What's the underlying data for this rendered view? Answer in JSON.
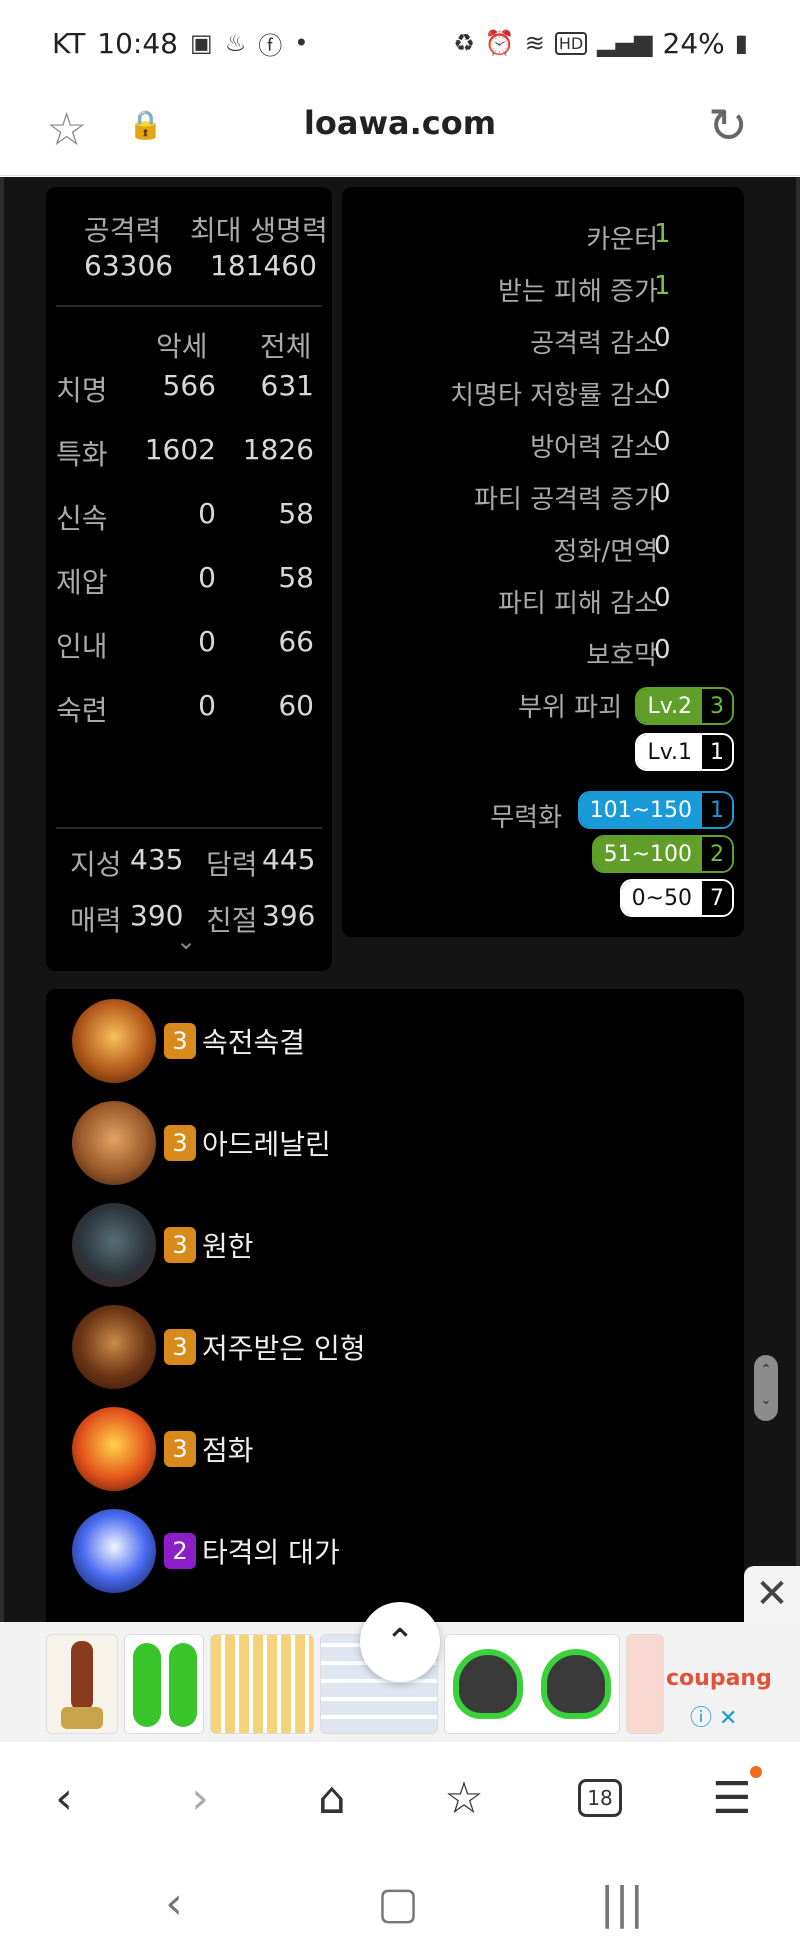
{
  "status": {
    "carrier": "KT",
    "time": "10:48",
    "battery": "24%",
    "icons_left": [
      "image-icon",
      "notification-icon",
      "facebook-icon",
      "dot-icon"
    ],
    "icons_right": [
      "recycle-icon",
      "alarm-icon",
      "wifi-icon",
      "hd-icon",
      "signal-icon",
      "battery-icon"
    ]
  },
  "browser": {
    "url": "loawa.com"
  },
  "stats": {
    "attack_label": "공격력",
    "attack_value": "63306",
    "hp_label": "최대 생명력",
    "hp_value": "181460",
    "col_accessory": "악세",
    "col_total": "전체",
    "rows": [
      {
        "name": "치명",
        "acc": "566",
        "total": "631"
      },
      {
        "name": "특화",
        "acc": "1602",
        "total": "1826"
      },
      {
        "name": "신속",
        "acc": "0",
        "total": "58"
      },
      {
        "name": "제압",
        "acc": "0",
        "total": "58"
      },
      {
        "name": "인내",
        "acc": "0",
        "total": "66"
      },
      {
        "name": "숙련",
        "acc": "0",
        "total": "60"
      }
    ],
    "traits": [
      {
        "name": "지성",
        "value": "435"
      },
      {
        "name": "담력",
        "value": "445"
      },
      {
        "name": "매력",
        "value": "390"
      },
      {
        "name": "친절",
        "value": "396"
      }
    ]
  },
  "synergy": {
    "rows": [
      {
        "label": "카운터",
        "value": "1",
        "highlight": true
      },
      {
        "label": "받는 피해 증가",
        "value": "1",
        "highlight": true
      },
      {
        "label": "공격력 감소",
        "value": "0",
        "highlight": false
      },
      {
        "label": "치명타 저항률 감소",
        "value": "0",
        "highlight": false
      },
      {
        "label": "방어력 감소",
        "value": "0",
        "highlight": false
      },
      {
        "label": "파티 공격력 증가",
        "value": "0",
        "highlight": false
      },
      {
        "label": "정화/면역",
        "value": "0",
        "highlight": false
      },
      {
        "label": "파티 피해 감소",
        "value": "0",
        "highlight": false
      },
      {
        "label": "보호막",
        "value": "0",
        "highlight": false
      }
    ],
    "destruction_label": "부위 파괴",
    "destruction_badges": [
      {
        "label": "Lv.2",
        "count": "3",
        "style": "green"
      },
      {
        "label": "Lv.1",
        "count": "1",
        "style": "white"
      }
    ],
    "stagger_label": "무력화",
    "stagger_badges": [
      {
        "label": "101~150",
        "count": "1",
        "style": "blue"
      },
      {
        "label": "51~100",
        "count": "2",
        "style": "green"
      },
      {
        "label": "0~50",
        "count": "7",
        "style": "white"
      }
    ]
  },
  "engravings": [
    {
      "level": "3",
      "name": "속전속결",
      "color": "#d98a1c",
      "icon": "engraving-swiftness-icon"
    },
    {
      "level": "3",
      "name": "아드레날린",
      "color": "#d98a1c",
      "icon": "engraving-adrenaline-icon"
    },
    {
      "level": "3",
      "name": "원한",
      "color": "#d98a1c",
      "icon": "engraving-grudge-icon"
    },
    {
      "level": "3",
      "name": "저주받은 인형",
      "color": "#d98a1c",
      "icon": "engraving-cursed-doll-icon"
    },
    {
      "level": "3",
      "name": "점화",
      "color": "#d98a1c",
      "icon": "engraving-ignition-icon"
    },
    {
      "level": "2",
      "name": "타격의 대가",
      "color": "#8a1fc8",
      "icon": "engraving-hit-master-icon"
    }
  ],
  "ad": {
    "brand": "coupang"
  },
  "toolbar": {
    "tab_count": "18"
  }
}
